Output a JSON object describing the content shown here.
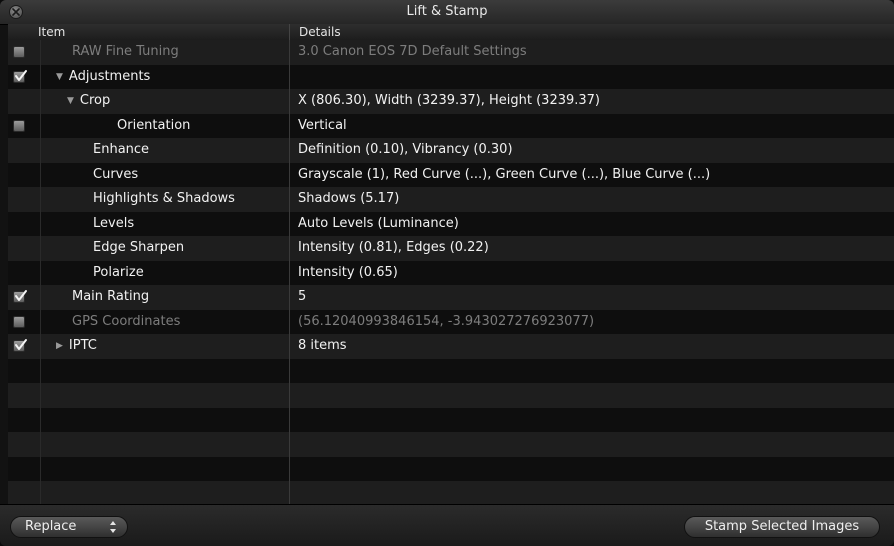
{
  "window": {
    "title": "Lift & Stamp"
  },
  "columns": {
    "item": "Item",
    "details": "Details"
  },
  "rows": [
    {
      "item": "RAW Fine Tuning",
      "details": "3.0 Canon EOS 7D Default Settings",
      "checkbox": "unchecked",
      "dim": true
    },
    {
      "item": "Adjustments",
      "details": "",
      "checkbox": "checked",
      "dim": false,
      "disclosure": "expanded"
    },
    {
      "item": "Crop",
      "details": "X (806.30), Width (3239.37), Height (3239.37)",
      "checkbox": "none",
      "dim": false,
      "disclosure": "expanded"
    },
    {
      "item": "Orientation",
      "details": "Vertical",
      "checkbox": "unchecked",
      "dim": false
    },
    {
      "item": "Enhance",
      "details": "Definition (0.10), Vibrancy (0.30)",
      "checkbox": "none",
      "dim": false
    },
    {
      "item": "Curves",
      "details": "Grayscale (1), Red Curve (...), Green Curve (...), Blue Curve (...)",
      "checkbox": "none",
      "dim": false
    },
    {
      "item": "Highlights & Shadows",
      "details": "Shadows (5.17)",
      "checkbox": "none",
      "dim": false
    },
    {
      "item": "Levels",
      "details": "Auto Levels (Luminance)",
      "checkbox": "none",
      "dim": false
    },
    {
      "item": "Edge Sharpen",
      "details": "Intensity (0.81), Edges (0.22)",
      "checkbox": "none",
      "dim": false
    },
    {
      "item": "Polarize",
      "details": "Intensity (0.65)",
      "checkbox": "none",
      "dim": false
    },
    {
      "item": "Main Rating",
      "details": "5",
      "checkbox": "checked",
      "dim": false
    },
    {
      "item": "GPS Coordinates",
      "details": "(56.12040993846154, -3.943027276923077)",
      "checkbox": "unchecked",
      "dim": true
    },
    {
      "item": "IPTC",
      "details": "8 items",
      "checkbox": "checked",
      "dim": false,
      "disclosure": "collapsed"
    }
  ],
  "footer": {
    "mode_select_value": "Replace",
    "stamp_button_label": "Stamp Selected Images"
  },
  "icons": {
    "close": "close-icon",
    "checkmark": "checkmark-icon",
    "disclosure_expanded": "triangle-down-icon",
    "disclosure_collapsed": "triangle-right-icon",
    "popup_arrows": "updown-arrows-icon"
  },
  "colors": {
    "background": "#121212",
    "row_alt": "#1e1e1e",
    "text": "#f2f2f2",
    "text_dim": "#7d7d7d"
  }
}
